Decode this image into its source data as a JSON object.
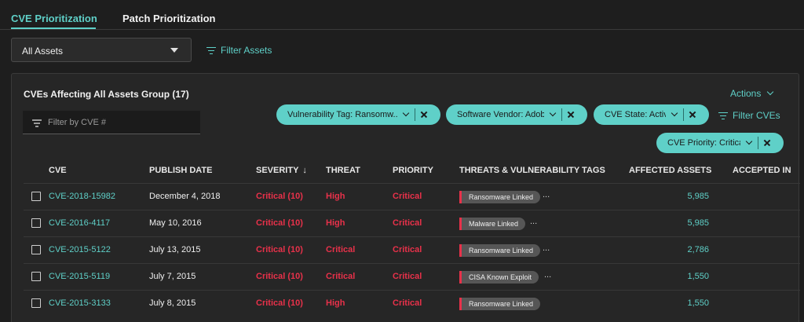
{
  "tabs": [
    {
      "label": "CVE Prioritization",
      "active": true
    },
    {
      "label": "Patch Prioritization",
      "active": false
    }
  ],
  "asset_select": {
    "value": "All Assets"
  },
  "filter_assets_label": "Filter Assets",
  "panel": {
    "title": "CVEs Affecting All Assets Group (17)",
    "actions_label": "Actions",
    "search_placeholder": "Filter by CVE #",
    "filter_cves_label": "Filter CVEs",
    "chips": [
      {
        "label": "Vulnerability Tag: Ransomw..."
      },
      {
        "label": "Software Vendor: Adobe"
      },
      {
        "label": "CVE State: Active"
      },
      {
        "label": "CVE Priority: Critical"
      }
    ]
  },
  "table": {
    "columns": [
      "CVE",
      "PUBLISH DATE",
      "SEVERITY",
      "THREAT",
      "PRIORITY",
      "THREATS & VULNERABILITY TAGS",
      "AFFECTED ASSETS",
      "ACCEPTED IN"
    ],
    "sort_indicator": "↓",
    "rows": [
      {
        "cve": "CVE-2018-15982",
        "date": "December 4, 2018",
        "severity": "Critical (10)",
        "threat": "High",
        "priority": "Critical",
        "tag": "Ransomware Linked",
        "more": "...",
        "assets": "5,985"
      },
      {
        "cve": "CVE-2016-4117",
        "date": "May 10, 2016",
        "severity": "Critical (10)",
        "threat": "High",
        "priority": "Critical",
        "tag": "Malware Linked",
        "more": "...",
        "assets": "5,985"
      },
      {
        "cve": "CVE-2015-5122",
        "date": "July 13, 2015",
        "severity": "Critical (10)",
        "threat": "Critical",
        "priority": "Critical",
        "tag": "Ransomware Linked",
        "more": "...",
        "assets": "2,786"
      },
      {
        "cve": "CVE-2015-5119",
        "date": "July 7, 2015",
        "severity": "Critical (10)",
        "threat": "Critical",
        "priority": "Critical",
        "tag": "CISA Known Exploit",
        "more": "...",
        "assets": "1,550"
      },
      {
        "cve": "CVE-2015-3133",
        "date": "July 8, 2015",
        "severity": "Critical (10)",
        "threat": "High",
        "priority": "Critical",
        "tag": "Ransomware Linked",
        "more": "...",
        "assets": "1,550"
      }
    ]
  },
  "colors": {
    "accent": "#5fd0c8",
    "critical": "#e8314a",
    "background": "#1e1e1e"
  }
}
